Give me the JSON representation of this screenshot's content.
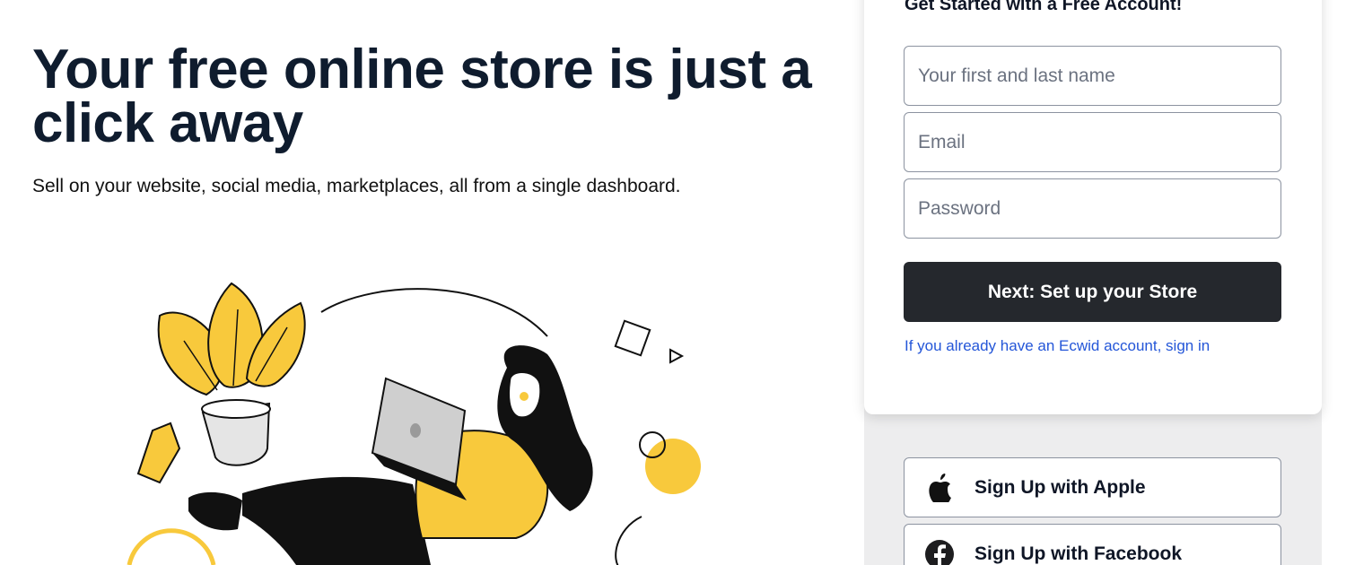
{
  "hero": {
    "title": "Your free online store is just a click away",
    "subtitle": "Sell on your website, social media, marketplaces, all from a single dashboard."
  },
  "signup": {
    "heading": "Get Started with a Free Account!",
    "name_placeholder": "Your first and last name",
    "email_placeholder": "Email",
    "password_placeholder": "Password",
    "submit_label": "Next: Set up your Store",
    "signin_link": "If you already have an Ecwid account, sign in",
    "apple_label": "Sign Up with Apple",
    "facebook_label": "Sign Up with Facebook"
  },
  "colors": {
    "accent_yellow": "#f8c93c",
    "button_dark": "#25282d",
    "link_blue": "#2456d8",
    "facebook": "#1d1d1f"
  },
  "icons": {
    "apple": "apple-icon",
    "facebook": "facebook-icon"
  }
}
